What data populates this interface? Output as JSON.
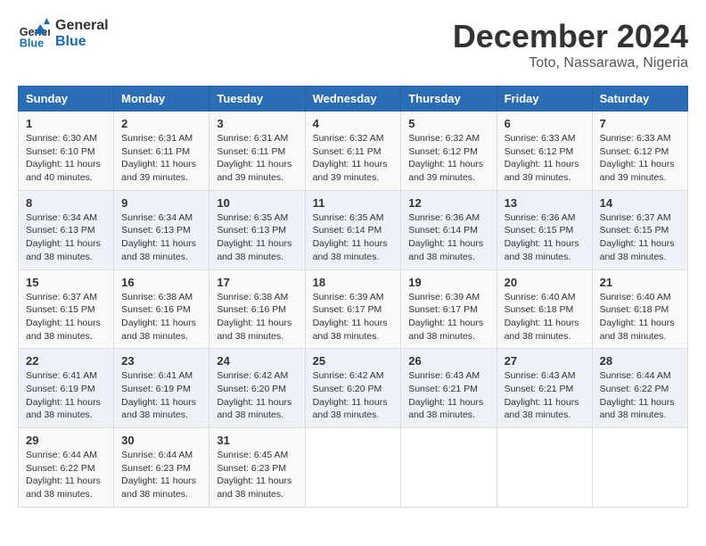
{
  "header": {
    "logo_line1": "General",
    "logo_line2": "Blue",
    "title": "December 2024",
    "subtitle": "Toto, Nassarawa, Nigeria"
  },
  "calendar": {
    "headers": [
      "Sunday",
      "Monday",
      "Tuesday",
      "Wednesday",
      "Thursday",
      "Friday",
      "Saturday"
    ],
    "weeks": [
      [
        null,
        {
          "day": 2,
          "sunrise": "6:31 AM",
          "sunset": "6:11 PM",
          "daylight": "11 hours and 39 minutes."
        },
        {
          "day": 3,
          "sunrise": "6:31 AM",
          "sunset": "6:11 PM",
          "daylight": "11 hours and 39 minutes."
        },
        {
          "day": 4,
          "sunrise": "6:32 AM",
          "sunset": "6:11 PM",
          "daylight": "11 hours and 39 minutes."
        },
        {
          "day": 5,
          "sunrise": "6:32 AM",
          "sunset": "6:12 PM",
          "daylight": "11 hours and 39 minutes."
        },
        {
          "day": 6,
          "sunrise": "6:33 AM",
          "sunset": "6:12 PM",
          "daylight": "11 hours and 39 minutes."
        },
        {
          "day": 7,
          "sunrise": "6:33 AM",
          "sunset": "6:12 PM",
          "daylight": "11 hours and 39 minutes."
        }
      ],
      [
        {
          "day": 1,
          "sunrise": "6:30 AM",
          "sunset": "6:10 PM",
          "daylight": "11 hours and 40 minutes."
        },
        null,
        null,
        null,
        null,
        null,
        null
      ],
      [
        {
          "day": 8,
          "sunrise": "6:34 AM",
          "sunset": "6:13 PM",
          "daylight": "11 hours and 38 minutes."
        },
        {
          "day": 9,
          "sunrise": "6:34 AM",
          "sunset": "6:13 PM",
          "daylight": "11 hours and 38 minutes."
        },
        {
          "day": 10,
          "sunrise": "6:35 AM",
          "sunset": "6:13 PM",
          "daylight": "11 hours and 38 minutes."
        },
        {
          "day": 11,
          "sunrise": "6:35 AM",
          "sunset": "6:14 PM",
          "daylight": "11 hours and 38 minutes."
        },
        {
          "day": 12,
          "sunrise": "6:36 AM",
          "sunset": "6:14 PM",
          "daylight": "11 hours and 38 minutes."
        },
        {
          "day": 13,
          "sunrise": "6:36 AM",
          "sunset": "6:15 PM",
          "daylight": "11 hours and 38 minutes."
        },
        {
          "day": 14,
          "sunrise": "6:37 AM",
          "sunset": "6:15 PM",
          "daylight": "11 hours and 38 minutes."
        }
      ],
      [
        {
          "day": 15,
          "sunrise": "6:37 AM",
          "sunset": "6:15 PM",
          "daylight": "11 hours and 38 minutes."
        },
        {
          "day": 16,
          "sunrise": "6:38 AM",
          "sunset": "6:16 PM",
          "daylight": "11 hours and 38 minutes."
        },
        {
          "day": 17,
          "sunrise": "6:38 AM",
          "sunset": "6:16 PM",
          "daylight": "11 hours and 38 minutes."
        },
        {
          "day": 18,
          "sunrise": "6:39 AM",
          "sunset": "6:17 PM",
          "daylight": "11 hours and 38 minutes."
        },
        {
          "day": 19,
          "sunrise": "6:39 AM",
          "sunset": "6:17 PM",
          "daylight": "11 hours and 38 minutes."
        },
        {
          "day": 20,
          "sunrise": "6:40 AM",
          "sunset": "6:18 PM",
          "daylight": "11 hours and 38 minutes."
        },
        {
          "day": 21,
          "sunrise": "6:40 AM",
          "sunset": "6:18 PM",
          "daylight": "11 hours and 38 minutes."
        }
      ],
      [
        {
          "day": 22,
          "sunrise": "6:41 AM",
          "sunset": "6:19 PM",
          "daylight": "11 hours and 38 minutes."
        },
        {
          "day": 23,
          "sunrise": "6:41 AM",
          "sunset": "6:19 PM",
          "daylight": "11 hours and 38 minutes."
        },
        {
          "day": 24,
          "sunrise": "6:42 AM",
          "sunset": "6:20 PM",
          "daylight": "11 hours and 38 minutes."
        },
        {
          "day": 25,
          "sunrise": "6:42 AM",
          "sunset": "6:20 PM",
          "daylight": "11 hours and 38 minutes."
        },
        {
          "day": 26,
          "sunrise": "6:43 AM",
          "sunset": "6:21 PM",
          "daylight": "11 hours and 38 minutes."
        },
        {
          "day": 27,
          "sunrise": "6:43 AM",
          "sunset": "6:21 PM",
          "daylight": "11 hours and 38 minutes."
        },
        {
          "day": 28,
          "sunrise": "6:44 AM",
          "sunset": "6:22 PM",
          "daylight": "11 hours and 38 minutes."
        }
      ],
      [
        {
          "day": 29,
          "sunrise": "6:44 AM",
          "sunset": "6:22 PM",
          "daylight": "11 hours and 38 minutes."
        },
        {
          "day": 30,
          "sunrise": "6:44 AM",
          "sunset": "6:23 PM",
          "daylight": "11 hours and 38 minutes."
        },
        {
          "day": 31,
          "sunrise": "6:45 AM",
          "sunset": "6:23 PM",
          "daylight": "11 hours and 38 minutes."
        },
        null,
        null,
        null,
        null
      ]
    ]
  },
  "labels": {
    "sunrise_label": "Sunrise:",
    "sunset_label": "Sunset:",
    "daylight_label": "Daylight:"
  }
}
